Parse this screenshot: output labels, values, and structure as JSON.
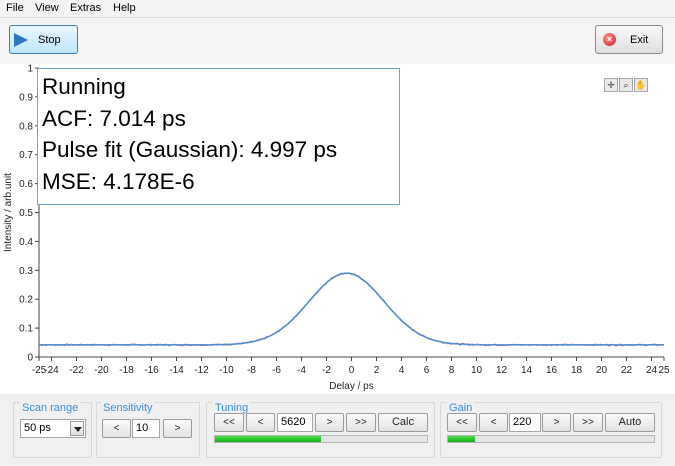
{
  "menu": [
    "File",
    "View",
    "Extras",
    "Help"
  ],
  "toolbar": {
    "stop_label": "Stop",
    "exit_label": "Exit"
  },
  "status": {
    "line1": "Running",
    "line2": "ACF: 7.014 ps",
    "line3": "Pulse fit (Gaussian): 4.997 ps",
    "line4": "MSE: 4.178E-6"
  },
  "plot_tools": [
    "crosshair-icon",
    "zoom-icon",
    "pan-hand-icon"
  ],
  "chart_data": {
    "type": "line",
    "xlabel": "Delay / ps",
    "ylabel": "Intensity / arb.unit",
    "xlim": [
      -25,
      25
    ],
    "ylim": [
      0,
      1.0
    ],
    "xticks": [
      "-25",
      "-24",
      "-22",
      "-20",
      "-18",
      "-16",
      "-14",
      "-12",
      "-10",
      "-8",
      "-6",
      "-4",
      "-2",
      "0",
      "2",
      "4",
      "6",
      "8",
      "10",
      "12",
      "14",
      "16",
      "18",
      "20",
      "22",
      "24",
      "25"
    ],
    "yticks": [
      "0",
      "0.1",
      "0.2",
      "0.3",
      "0.4",
      "0.5",
      "0.6",
      "0.7",
      "0.8",
      "0.9",
      "1"
    ],
    "series": [
      {
        "kind": "measured",
        "color": "#d03a3a",
        "baseline": 0.042,
        "peak": 0.29,
        "center": -0.4,
        "sigma": 3.0
      },
      {
        "kind": "gaussian-fit",
        "color": "#3a8fe0",
        "baseline": 0.042,
        "peak": 0.29,
        "center": -0.4,
        "sigma": 3.0
      }
    ]
  },
  "controls": {
    "scan_range": {
      "title": "Scan range",
      "value": "50 ps"
    },
    "sensitivity": {
      "title": "Sensitivity",
      "dec": "<",
      "value": "10",
      "inc": ">"
    },
    "tuning": {
      "title": "Tuning",
      "fast_dec": "<<",
      "dec": "<",
      "value": "5620",
      "inc": ">",
      "fast_inc": ">>",
      "calc": "Calc",
      "level": 0.5
    },
    "gain": {
      "title": "Gain",
      "fast_dec": "<<",
      "dec": "<",
      "value": "220",
      "inc": ">",
      "fast_inc": ">>",
      "auto": "Auto",
      "level": 0.13
    }
  },
  "colors": {
    "accent": "#3a8fd6",
    "progress": "#20c020",
    "status_border": "#6aa6d8"
  }
}
